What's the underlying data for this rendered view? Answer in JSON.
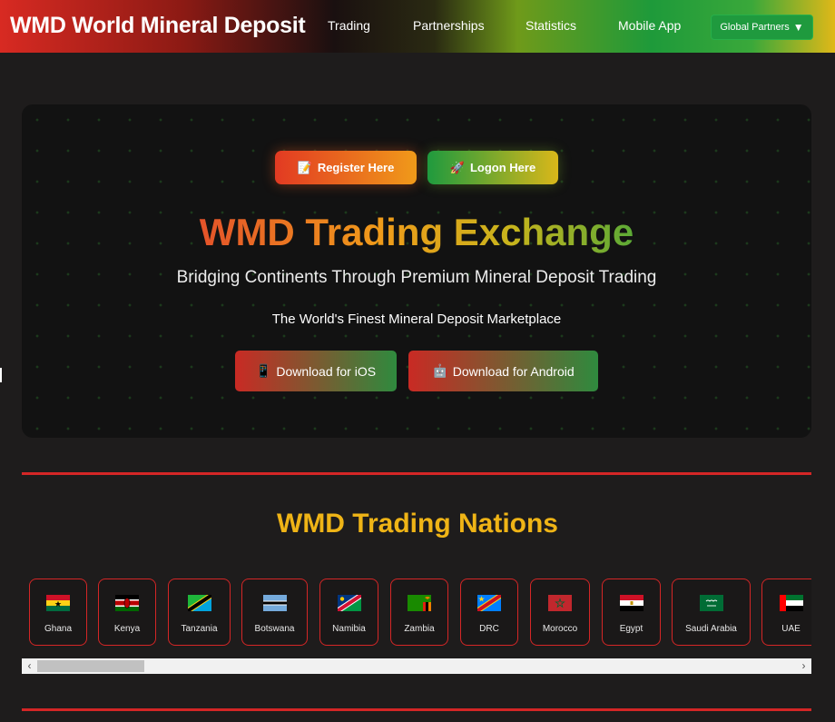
{
  "nav": {
    "brand": "WMD World Mineral Deposit",
    "links": [
      "Trading",
      "Partnerships",
      "Statistics",
      "Mobile App"
    ],
    "partners_label": "Global Partners",
    "partners_arrow": "▼"
  },
  "hero": {
    "register_icon": "📝",
    "register_label": "Register Here",
    "logon_icon": "🚀",
    "logon_label": "Logon Here",
    "title": "WMD Trading Exchange",
    "subtitle": "Bridging Continents Through Premium Mineral Deposit Trading",
    "tagline": "The World's Finest Mineral Deposit Marketplace",
    "ios_icon": "📱",
    "ios_label": "Download for iOS",
    "android_icon": "🤖",
    "android_label": "Download for Android"
  },
  "nations": {
    "title": "WMD Trading Nations",
    "items": [
      {
        "name": "Ghana",
        "flag": "ghana-flag-icon"
      },
      {
        "name": "Kenya",
        "flag": "kenya-flag-icon"
      },
      {
        "name": "Tanzania",
        "flag": "tanzania-flag-icon"
      },
      {
        "name": "Botswana",
        "flag": "botswana-flag-icon"
      },
      {
        "name": "Namibia",
        "flag": "namibia-flag-icon"
      },
      {
        "name": "Zambia",
        "flag": "zambia-flag-icon"
      },
      {
        "name": "DRC",
        "flag": "drc-flag-icon"
      },
      {
        "name": "Morocco",
        "flag": "morocco-flag-icon"
      },
      {
        "name": "Egypt",
        "flag": "egypt-flag-icon"
      },
      {
        "name": "Saudi Arabia",
        "flag": "saudi-arabia-flag-icon"
      },
      {
        "name": "UAE",
        "flag": "uae-flag-icon"
      }
    ]
  },
  "scroll": {
    "left_arrow": "‹",
    "right_arrow": "›"
  },
  "colors": {
    "accent_red": "#d42626",
    "accent_gold": "#efb416",
    "accent_green": "#1f9a3e",
    "background": "#1e1c1c"
  }
}
